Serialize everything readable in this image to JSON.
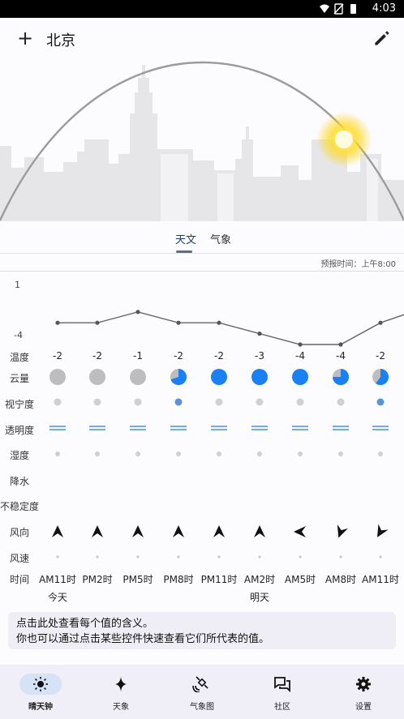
{
  "status_bar": {
    "time": "4:03"
  },
  "header": {
    "add_icon": "+",
    "city": "北京"
  },
  "tabs": [
    {
      "label": "天文"
    },
    {
      "label": "气象"
    }
  ],
  "forecast_time": "预报时间：上午8:00",
  "chart_data": {
    "type": "line",
    "x": [
      "AM11时",
      "PM2时",
      "PM5时",
      "PM8时",
      "PM11时",
      "AM2时",
      "AM5时",
      "AM8时",
      "AM11时"
    ],
    "values": [
      -2,
      -2,
      -1,
      -2,
      -2,
      -3,
      -4,
      -4,
      -2
    ],
    "scale_top": "1",
    "scale_bottom": "-4",
    "ylim": [
      -4,
      1
    ]
  },
  "rows": {
    "temperature": {
      "label": "温度",
      "values": [
        "-2",
        "-2",
        "-1",
        "-2",
        "-2",
        "-3",
        "-4",
        "-4",
        "-2"
      ]
    },
    "cloud": {
      "label": "云量",
      "levels": [
        0,
        0,
        0,
        0.7,
        1,
        1,
        1,
        0.75,
        0.6
      ]
    },
    "seeing": {
      "label": "视宁度",
      "highlight": [
        false,
        false,
        false,
        true,
        false,
        false,
        false,
        false,
        true
      ]
    },
    "transparency": {
      "label": "透明度"
    },
    "humidity": {
      "label": "湿度"
    },
    "precipitation": {
      "label": "降水"
    },
    "instability": {
      "label": "不稳定度"
    },
    "wind_direction": {
      "label": "风向",
      "angles": [
        0,
        0,
        0,
        0,
        0,
        0,
        270,
        200,
        210
      ]
    },
    "wind_speed": {
      "label": "风速"
    },
    "time": {
      "label": "时间",
      "values": [
        "AM11时",
        "PM2时",
        "PM5时",
        "PM8时",
        "PM11时",
        "AM2时",
        "AM5时",
        "AM8时",
        "AM11时"
      ],
      "day_markers": [
        {
          "index": 0,
          "text": "今天"
        },
        {
          "index": 5,
          "text": "明天"
        }
      ]
    }
  },
  "tip": {
    "line1": "点击此处查看每个值的含义。",
    "line2": "你也可以通过点击某些控件快速查看它们所代表的值。"
  },
  "bottom_nav": [
    {
      "label": "晴天钟",
      "icon": "sun-icon",
      "active": true
    },
    {
      "label": "天象",
      "icon": "sparkle-icon",
      "active": false
    },
    {
      "label": "气象图",
      "icon": "satellite-icon",
      "active": false
    },
    {
      "label": "社区",
      "icon": "chat-icon",
      "active": false
    },
    {
      "label": "设置",
      "icon": "gear-icon",
      "active": false
    }
  ],
  "colors": {
    "accent": "#1a80f5",
    "cloud_gray": "#bdbdbd",
    "nav_active": "#d6e3f7",
    "sun": "#ffe94d"
  }
}
